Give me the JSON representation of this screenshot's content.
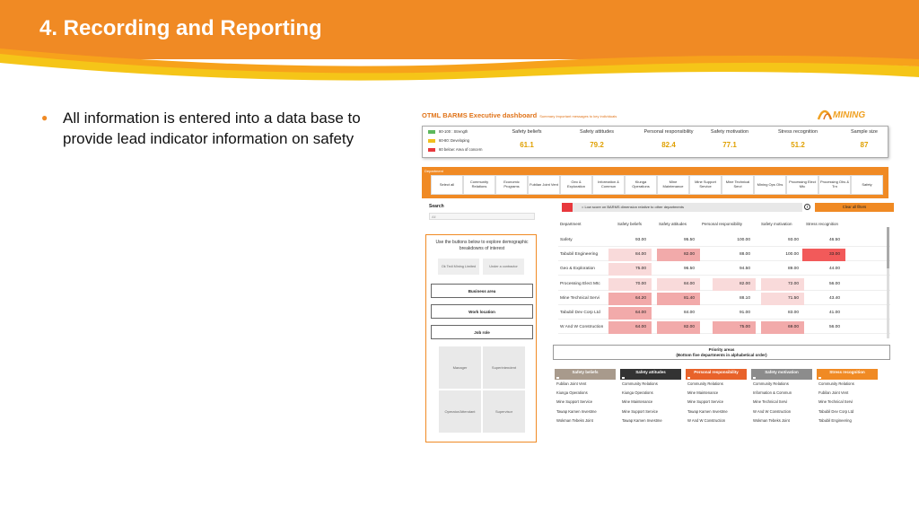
{
  "slide": {
    "title": "4. Recording and Reporting",
    "bullet": "All information is entered into a data base to provide lead indicator information on safety"
  },
  "dashboard": {
    "title": "OTML BARMS Executive dashboard",
    "subtitle": "Summary Important messages to key individuals",
    "logo_text": "MINING",
    "legend": [
      {
        "label": "80-100 : Strength",
        "color": "#5cb85c"
      },
      {
        "label": "60-80: Developing",
        "color": "#f0c020"
      },
      {
        "label": "60 below: Area of concern",
        "color": "#e8383d"
      }
    ],
    "kpis": [
      {
        "label": "Safety beliefs",
        "value": "61.1"
      },
      {
        "label": "Safety attitudes",
        "value": "79.2"
      },
      {
        "label": "Personal responsibility",
        "value": "82.4"
      },
      {
        "label": "Safety motivation",
        "value": "77.1"
      },
      {
        "label": "Stress recognition",
        "value": "51.2"
      },
      {
        "label": "Sample size",
        "value": "87"
      }
    ],
    "department_label": "Department",
    "departments": [
      "Select all",
      "Community Relations",
      "Economic Programs",
      "Fubilan Joint Vent",
      "Geo & Exploration",
      "Information & Commun",
      "Kiunga Operations",
      "Mine Maintenance",
      "Mine Support Service",
      "Mine Technical Servi",
      "Mining Ops Ohs",
      "Processing Elect Mtc",
      "Processing Ohs & Trn",
      "Safety"
    ],
    "search": {
      "label": "Search",
      "value": "All"
    },
    "left_panel": {
      "instruction": "Use the buttons below to explore demographic breakdowns of interest",
      "options": [
        "Ok Tedi Mining Limited",
        "Under a contractor"
      ],
      "buttons": [
        "Business area",
        "Work location",
        "Job role"
      ],
      "roles": [
        "Manager",
        "Superintendent",
        "Operator/Attendant",
        "Supervisor"
      ]
    },
    "filter_text": "= Low score on BARMS dimension relative to other departments",
    "clear_filters": "Clear all filters",
    "warn_glyph": "!",
    "table": {
      "headers": [
        "Department",
        "Safety beliefs",
        "Safety attitudes",
        "Personal responsibility",
        "Safety motivation",
        "Stress recognition"
      ],
      "rows": [
        {
          "name": "Safety",
          "values": [
            "93.00",
            "95.50",
            "100.00",
            "93.00",
            "46.50"
          ],
          "shade": [
            0,
            0,
            0,
            0,
            0
          ]
        },
        {
          "name": "Tabubil Engineering",
          "values": [
            "84.00",
            "82.00",
            "88.00",
            "100.00",
            "33.00"
          ],
          "shade": [
            1,
            2,
            0,
            0,
            3
          ]
        },
        {
          "name": "Geo & Exploration",
          "values": [
            "75.00",
            "96.50",
            "94.50",
            "89.00",
            "44.00"
          ],
          "shade": [
            1,
            0,
            0,
            0,
            0
          ]
        },
        {
          "name": "Processing Elect Mtc",
          "values": [
            "70.00",
            "84.00",
            "82.00",
            "72.00",
            "56.00"
          ],
          "shade": [
            1,
            1,
            1,
            1,
            0
          ]
        },
        {
          "name": "Mine Technical Servi",
          "values": [
            "64.20",
            "81.40",
            "88.10",
            "71.50",
            "43.40"
          ],
          "shade": [
            2,
            2,
            0,
            1,
            0
          ]
        },
        {
          "name": "Tabubil Dev Corp Ltd",
          "values": [
            "64.00",
            "84.00",
            "91.00",
            "83.00",
            "41.00"
          ],
          "shade": [
            2,
            0,
            0,
            0,
            0
          ]
        },
        {
          "name": "W And W Construction",
          "values": [
            "64.00",
            "82.00",
            "75.00",
            "69.00",
            "56.00"
          ],
          "shade": [
            2,
            2,
            2,
            2,
            0
          ]
        }
      ]
    },
    "priority": {
      "title": "Priority areas",
      "subtitle": "(Bottom five departments in alphabetical order)",
      "columns": [
        {
          "head": "Safety beliefs",
          "color": "#a89a8c",
          "items": [
            "Fubilan Joint Vent",
            "Kiunga Operations",
            "Mine Support Service",
            "Tawap Kamen Investme",
            "Wokman Tebeks Joint"
          ]
        },
        {
          "head": "Safety attitudes",
          "color": "#333333",
          "items": [
            "Community Relations",
            "Kiunga Operations",
            "Mine Maintenance",
            "Mine Support Service",
            "Tawap Kamen Investme"
          ]
        },
        {
          "head": "Personal responsibility",
          "color": "#e8622a",
          "items": [
            "Community Relations",
            "Mine Maintenance",
            "Mine Support Service",
            "Tawap Kamen Investme",
            "W And W Construction"
          ]
        },
        {
          "head": "Safety motivation",
          "color": "#8c8c8c",
          "items": [
            "Community Relations",
            "Information & Commun",
            "Mine Technical Servi",
            "W And W Construction",
            "Wokman Tebeks Joint"
          ]
        },
        {
          "head": "Stress recognition",
          "color": "#f08a24",
          "items": [
            "Community Relations",
            "Fubilan Joint Vent",
            "Mine Technical Servi",
            "Tabubil Dev Corp Ltd",
            "Tabubil Engineering"
          ]
        }
      ]
    }
  }
}
